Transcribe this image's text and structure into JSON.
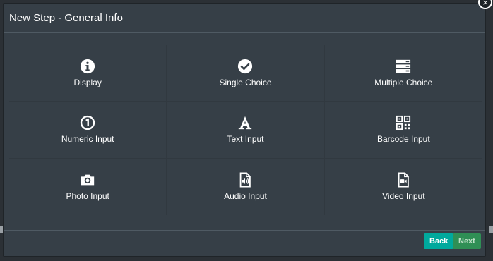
{
  "modal": {
    "title": "New Step - General Info",
    "close_label": "×"
  },
  "step_types": [
    {
      "label": "Display",
      "icon": "info-circle-icon"
    },
    {
      "label": "Single Choice",
      "icon": "check-circle-icon"
    },
    {
      "label": "Multiple Choice",
      "icon": "list-stack-icon"
    },
    {
      "label": "Numeric Input",
      "icon": "number-one-circle-icon"
    },
    {
      "label": "Text Input",
      "icon": "font-letter-a-icon"
    },
    {
      "label": "Barcode Input",
      "icon": "qr-code-icon"
    },
    {
      "label": "Photo Input",
      "icon": "camera-icon"
    },
    {
      "label": "Audio Input",
      "icon": "audio-file-icon"
    },
    {
      "label": "Video Input",
      "icon": "video-file-icon"
    }
  ],
  "footer": {
    "back_label": "Back",
    "next_label": "Next"
  },
  "colors": {
    "modal_bg": "#363f47",
    "back_button": "#00a99d",
    "next_button": "#2f8f55"
  }
}
